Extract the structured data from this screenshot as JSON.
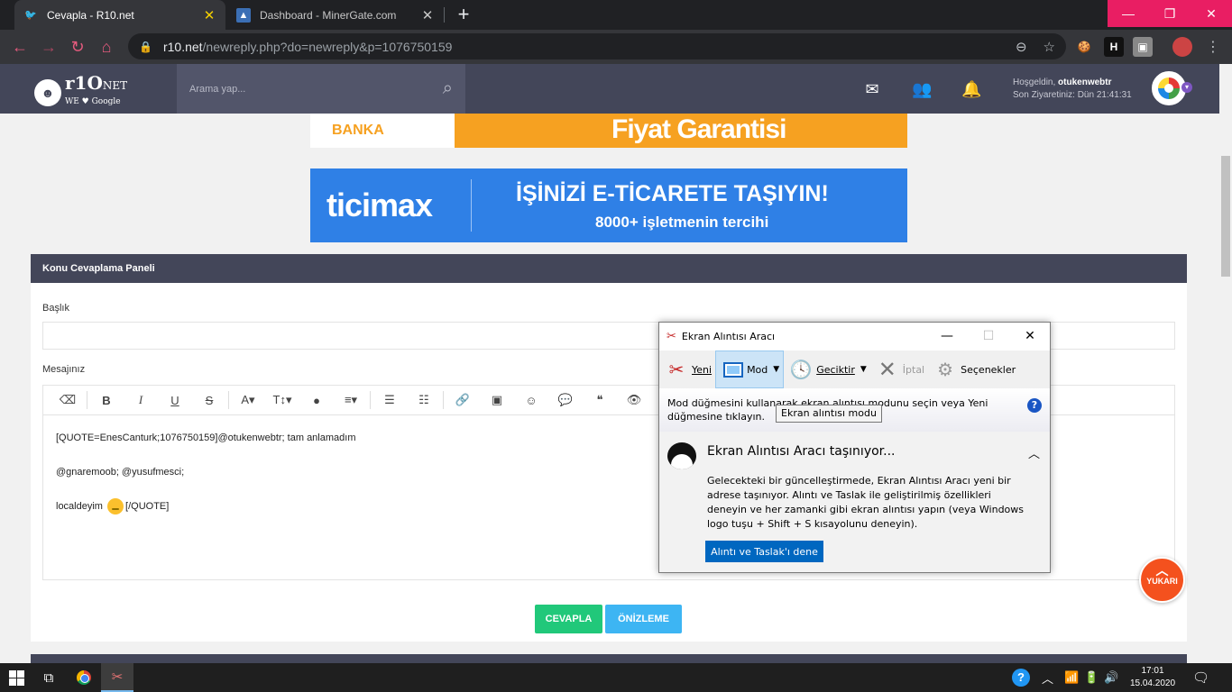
{
  "browser": {
    "tabs": [
      {
        "title": "Cevapla - R10.net",
        "active": true
      },
      {
        "title": "Dashboard - MinerGate.com",
        "active": false
      }
    ],
    "url_host": "r10.net",
    "url_path": "/newreply.php?do=newreply&p=1076750159"
  },
  "site": {
    "logo_main": "r1O",
    "logo_suffix": "NET",
    "logo_sub": "WE ♥ Google",
    "search_placeholder": "Arama yap...",
    "welcome_prefix": "Hoşgeldin,",
    "username": "otukenwebtr",
    "last_visit": "Son Ziyaretiniz: Dün 21:41:31"
  },
  "ads": {
    "ad1_brand": "BANKA",
    "ad1_text": "Fiyat Garantisi",
    "ad2_brand": "ticimax",
    "ad2_headline": "İŞİNİZİ E-TİCARETE TAŞIYIN!",
    "ad2_sub": "8000+ işletmenin tercihi"
  },
  "panel": {
    "title": "Konu Cevaplama Paneli",
    "label_title": "Başlık",
    "label_message": "Mesajınız",
    "message_lines": [
      "[QUOTE=EnesCanturk;1076750159]@otukenwebtr; tam anlamadım",
      "@gnaremoob; @yusufmesci;",
      "localdeyim",
      "[/QUOTE]"
    ],
    "btn_reply": "CEVAPLA",
    "btn_preview": "ÖNİZLEME",
    "toolbar": [
      "⌫",
      "B",
      "I",
      "U",
      "S",
      "A▾",
      "T↕▾",
      "●",
      "≡▾",
      "☰",
      "☷",
      "🔗",
      "▣",
      "☺",
      "💬",
      "❝",
      "👁",
      "⋯"
    ]
  },
  "scroll_top": {
    "label": "YUKARI"
  },
  "snipping": {
    "title": "Ekran Alıntısı Aracı",
    "tools": {
      "new": "Yeni",
      "mode": "Mod",
      "delay": "Geciktir",
      "cancel": "İptal",
      "options": "Seçenekler"
    },
    "info": "Mod düğmesini kullanarak ekran alıntısı modunu seçin veya Yeni düğmesine tıklayın.",
    "tooltip": "Ekran alıntısı modu",
    "notice_title": "Ekran Alıntısı Aracı taşınıyor...",
    "notice_body": "Gelecekteki bir güncelleştirmede, Ekran Alıntısı Aracı yeni bir adrese taşınıyor. Alıntı ve Taslak ile geliştirilmiş özellikleri deneyin ve her zamanki gibi ekran alıntısı yapın (veya Windows logo tuşu + Shift + S kısayolunu deneyin).",
    "notice_button": "Alıntı ve Taslak'ı dene"
  },
  "taskbar": {
    "time": "17:01",
    "date": "15.04.2020"
  }
}
